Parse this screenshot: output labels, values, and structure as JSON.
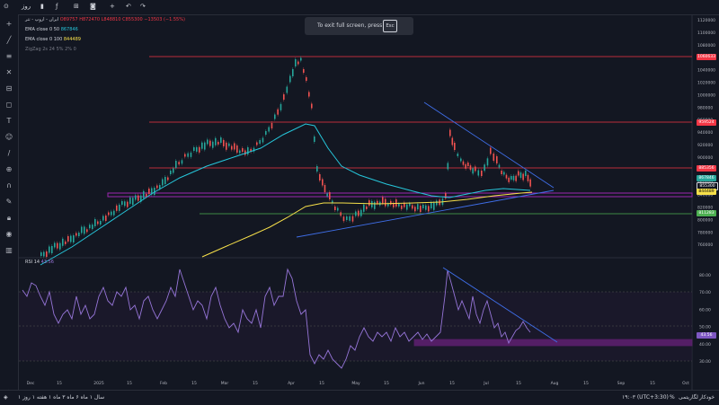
{
  "topbar": {
    "symbol_short": "روز",
    "icons": [
      "plus-icon",
      "indicator-icon",
      "grid-icon",
      "camera-icon",
      "undo-icon",
      "redo-icon"
    ]
  },
  "legend": {
    "title": "ایران - اروپ - تتر",
    "open": "O89757",
    "high": "H872470",
    "low": "L848810",
    "close": "C855300",
    "change": "−13503 (−1.55%)",
    "ema50_label": "EMA close 0 50",
    "ema50_value": "867846",
    "ema100_label": "EMA close 0 100",
    "ema100_value": "844489",
    "extra_label": "ZigZag 2s 24 5% 2% 0"
  },
  "toast": {
    "message": "To exit full screen, press",
    "key": "Esc"
  },
  "price_axis": [
    "1120000",
    "1100000",
    "1080000",
    "1060000",
    "1040000",
    "1020000",
    "1000000",
    "980000",
    "960000",
    "940000",
    "920000",
    "900000",
    "880000",
    "860000",
    "840000",
    "820000",
    "800000",
    "780000",
    "760000"
  ],
  "price_tags": [
    {
      "label": "1060633",
      "color": "#f23645"
    },
    {
      "label": "959524",
      "color": "#f23645"
    },
    {
      "label": "885356",
      "color": "#f23645"
    },
    {
      "label": "867846",
      "color": "#26a69a"
    },
    {
      "label": "855300",
      "color": "#131722"
    },
    {
      "label": "844489",
      "color": "#f7e04a"
    },
    {
      "label": "811283",
      "color": "#4caf50"
    }
  ],
  "rsi": {
    "label": "RSI 14",
    "value": "43.56",
    "axis": [
      "80.00",
      "70.00",
      "60.00",
      "50.00",
      "40.00",
      "30.00"
    ],
    "tag": "43.56"
  },
  "time_axis": [
    "Dec",
    "15",
    "2025",
    "15",
    "Feb",
    "15",
    "Mar",
    "15",
    "Apr",
    "15",
    "May",
    "15",
    "Jun",
    "15",
    "Jul",
    "15",
    "Aug",
    "15",
    "Sep",
    "15",
    "Oct"
  ],
  "bottombar": {
    "range_left": "سال ۱  ماه ۶  ماه ۳  ماه ۱  هفته ۱  روز ۱",
    "time": "۱۹:۰۳ (UTC+3:30)",
    "percent": "%",
    "log": "لگاریتمی",
    "auto": "خودکار"
  }
}
